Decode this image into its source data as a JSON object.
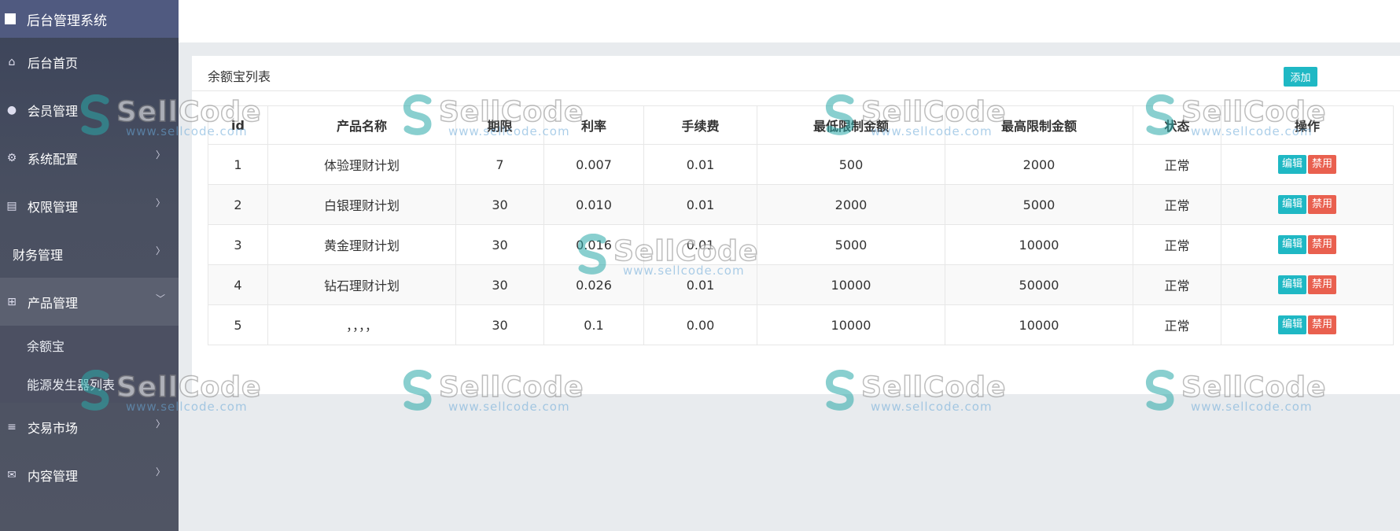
{
  "sidebar": {
    "brand": "后台管理系统",
    "items": [
      {
        "label": "后台首页",
        "icon": "home-icon",
        "glyph": "⌂",
        "chevron": false
      },
      {
        "label": "会员管理",
        "icon": "user-icon",
        "glyph": "●",
        "chevron": false
      },
      {
        "label": "系统配置",
        "icon": "gears-icon",
        "glyph": "⚙",
        "chevron": true
      },
      {
        "label": "权限管理",
        "icon": "server-icon",
        "glyph": "▤",
        "chevron": true
      },
      {
        "label": "财务管理",
        "icon": "",
        "glyph": "",
        "chevron": true
      },
      {
        "label": "产品管理",
        "icon": "windows-icon",
        "glyph": "⊞",
        "chevron": true,
        "open": true
      }
    ],
    "submenu": [
      "余额宝",
      "能源发生器列表"
    ],
    "items_after": [
      {
        "label": "交易市场",
        "icon": "list-icon",
        "glyph": "≡",
        "chevron": true
      },
      {
        "label": "内容管理",
        "icon": "envelope-icon",
        "glyph": "✉",
        "chevron": true
      }
    ]
  },
  "panel": {
    "title": "余额宝列表",
    "add_label": "添加"
  },
  "table": {
    "headers": [
      "id",
      "产品名称",
      "期限",
      "利率",
      "手续费",
      "最低限制金额",
      "最高限制金额",
      "状态",
      "操作"
    ],
    "rows": [
      [
        "1",
        "体验理财计划",
        "7",
        "0.007",
        "0.01",
        "500",
        "2000",
        "正常"
      ],
      [
        "2",
        "白银理财计划",
        "30",
        "0.010",
        "0.01",
        "2000",
        "5000",
        "正常"
      ],
      [
        "3",
        "黄金理财计划",
        "30",
        "0.016",
        "0.01",
        "5000",
        "10000",
        "正常"
      ],
      [
        "4",
        "钻石理财计划",
        "30",
        "0.026",
        "0.01",
        "10000",
        "50000",
        "正常"
      ],
      [
        "5",
        "，，，，",
        "30",
        "0.1",
        "0.00",
        "10000",
        "10000",
        "正常"
      ]
    ],
    "edit_label": "编辑",
    "disable_label": "禁用"
  },
  "watermark": {
    "brand": "SellCode",
    "url": "www.sellcode.com"
  },
  "colors": {
    "accent": "#1fb8c4",
    "danger": "#e9604f",
    "sidebar": "#4a5061"
  }
}
